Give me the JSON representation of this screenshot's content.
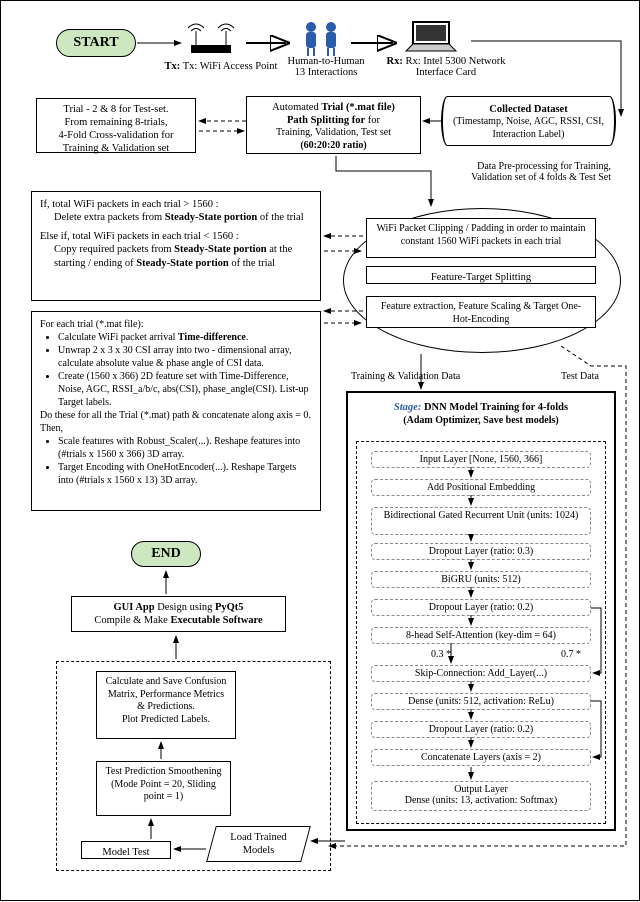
{
  "start": "START",
  "end": "END",
  "tx": "Tx: WiFi Access Point",
  "human": "Human-to-Human\n13 Interactions",
  "rx": "Rx: Intel 5300 Network Interface Card",
  "dataset_title": "Collected Dataset",
  "dataset_detail": "(Timestamp, Noise, AGC, RSSI, CSI, Interaction Label)",
  "split_l1": "Automated Trial (*.mat file)",
  "split_l2": "Path Splitting for",
  "split_l3": "Training, Validation, Test set",
  "split_l4": "(60:20:20 ratio)",
  "trials_l1": "Trial - 2 & 8 for Test-set.",
  "trials_l2": "From remaining 8-trials,",
  "trials_l3": "4-Fold Cross-validation for",
  "trials_l4": "Training & Validation set",
  "preproc_note": "Data Pre-processing for Training, Validation set of 4 folds & Test Set",
  "clip_l1": "WiFi Packet Clipping / Padding in order to maintain constant 1560 WiFi packets in each trial",
  "featsplit": "Feature-Target Splitting",
  "featext": "Feature extraction, Feature Scaling & Target One-Hot-Encoding",
  "ifblock_l1": "If, total WiFi packets in each trial > 1560 :",
  "ifblock_l2": "Delete extra packets from Steady-State portion of the trial",
  "ifblock_l3": "Else if, total WiFi packets in each trial < 1560 :",
  "ifblock_l4": "Copy required packets from Steady-State portion at the starting / ending of Steady-State portion of the trial",
  "foreach_head": "For each trial (*.mat file):",
  "fe_b1": "Calculate WiFi packet arrival Time-difference.",
  "fe_b2": "Unwrap 2 x 3 x 30 CSI array into two - dimensional array, calculate absolute value & phase angle of CSI data.",
  "fe_b3": "Create (1560 x 366) 2D feature set with Time-Difference, Noise, AGC, RSSI_a/b/c, abs(CSI), phase_angle(CSI). List-up Target labels.",
  "fe_mid": "Do these for all the Trial (*.mat) path & concatenate along axis = 0. Then,",
  "fe_b4": "Scale features with Robust_Scaler(...). Reshape features into (#trials x 1560 x 366) 3D array.",
  "fe_b5": "Target Encoding with OneHotEncoder(...). Reshape Targets into (#trials x 1560 x 13) 3D array.",
  "traindata": "Training & Validation Data",
  "testdata": "Test Data",
  "stage_prefix": "Stage:",
  "stage_title": "DNN Model Training for 4-folds",
  "stage_sub": "(Adam Optimizer, Save best models)",
  "layers": [
    "Input Layer [None, 1560, 366]",
    "Add Positional Embedding",
    "Bidirectional Gated Recurrent Unit (units: 1024)",
    "Dropout Layer (ratio: 0.3)",
    "BiGRU (units: 512)",
    "Dropout Layer (ratio: 0.2)",
    "8-head Self-Attention (key-dim = 64)",
    "Skip-Connection: Add_Layer(...)",
    "Dense (units: 512, activation: ReLu)",
    "Dropout Layer (ratio: 0.2)",
    "Concatenate Layers (axis = 2)",
    "Output Layer\nDense (units: 13, activation: Softmax)"
  ],
  "w03": "0.3 *",
  "w07": "0.7 *",
  "load": "Load Trained Models",
  "modeltest": "Model Test",
  "smooth_l1": "Test Prediction Smoothening",
  "smooth_l2": "(Mode Point = 20, Sliding point = 1)",
  "calc_l1": "Calculate and Save Confusion Matrix, Performance Metrics & Predictions.",
  "calc_l2": "Plot Predicted Labels.",
  "gui_l1": "GUI App Design using PyQt5",
  "gui_l2": "Compile & Make Executable Software"
}
